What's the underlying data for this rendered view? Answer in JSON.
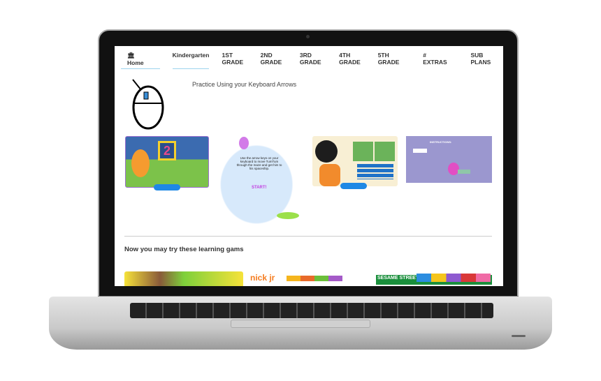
{
  "nav": {
    "items": [
      {
        "label": "Home",
        "icon": "bank-icon"
      },
      {
        "label": "Kindergarten"
      },
      {
        "label": "1ST GRADE"
      },
      {
        "label": "2ND GRADE"
      },
      {
        "label": "3RD GRADE"
      },
      {
        "label": "4TH GRADE"
      },
      {
        "label": "5TH GRADE"
      },
      {
        "label": "EXTRAS",
        "icon": "hash-icon"
      },
      {
        "label": "SUB PLANS"
      }
    ]
  },
  "main": {
    "heading": "Practice Using your Keyboard Arrows",
    "games": [
      {
        "big_number": "2"
      },
      {
        "instructions": "Use the arrow keys on your keyboard to move TumTum through the maze and get him to his spaceship.",
        "start": "START!"
      },
      {},
      {
        "instructions_title": "INSTRUCTIONS:"
      }
    ],
    "subheading": "Now you may try these learning gams",
    "more_games": [
      {},
      {
        "logo": "nickjr"
      },
      {
        "logo": "SESAME STREET"
      }
    ]
  },
  "colors": {
    "accent": "#9cd3ee",
    "button": "#1e88e5"
  }
}
